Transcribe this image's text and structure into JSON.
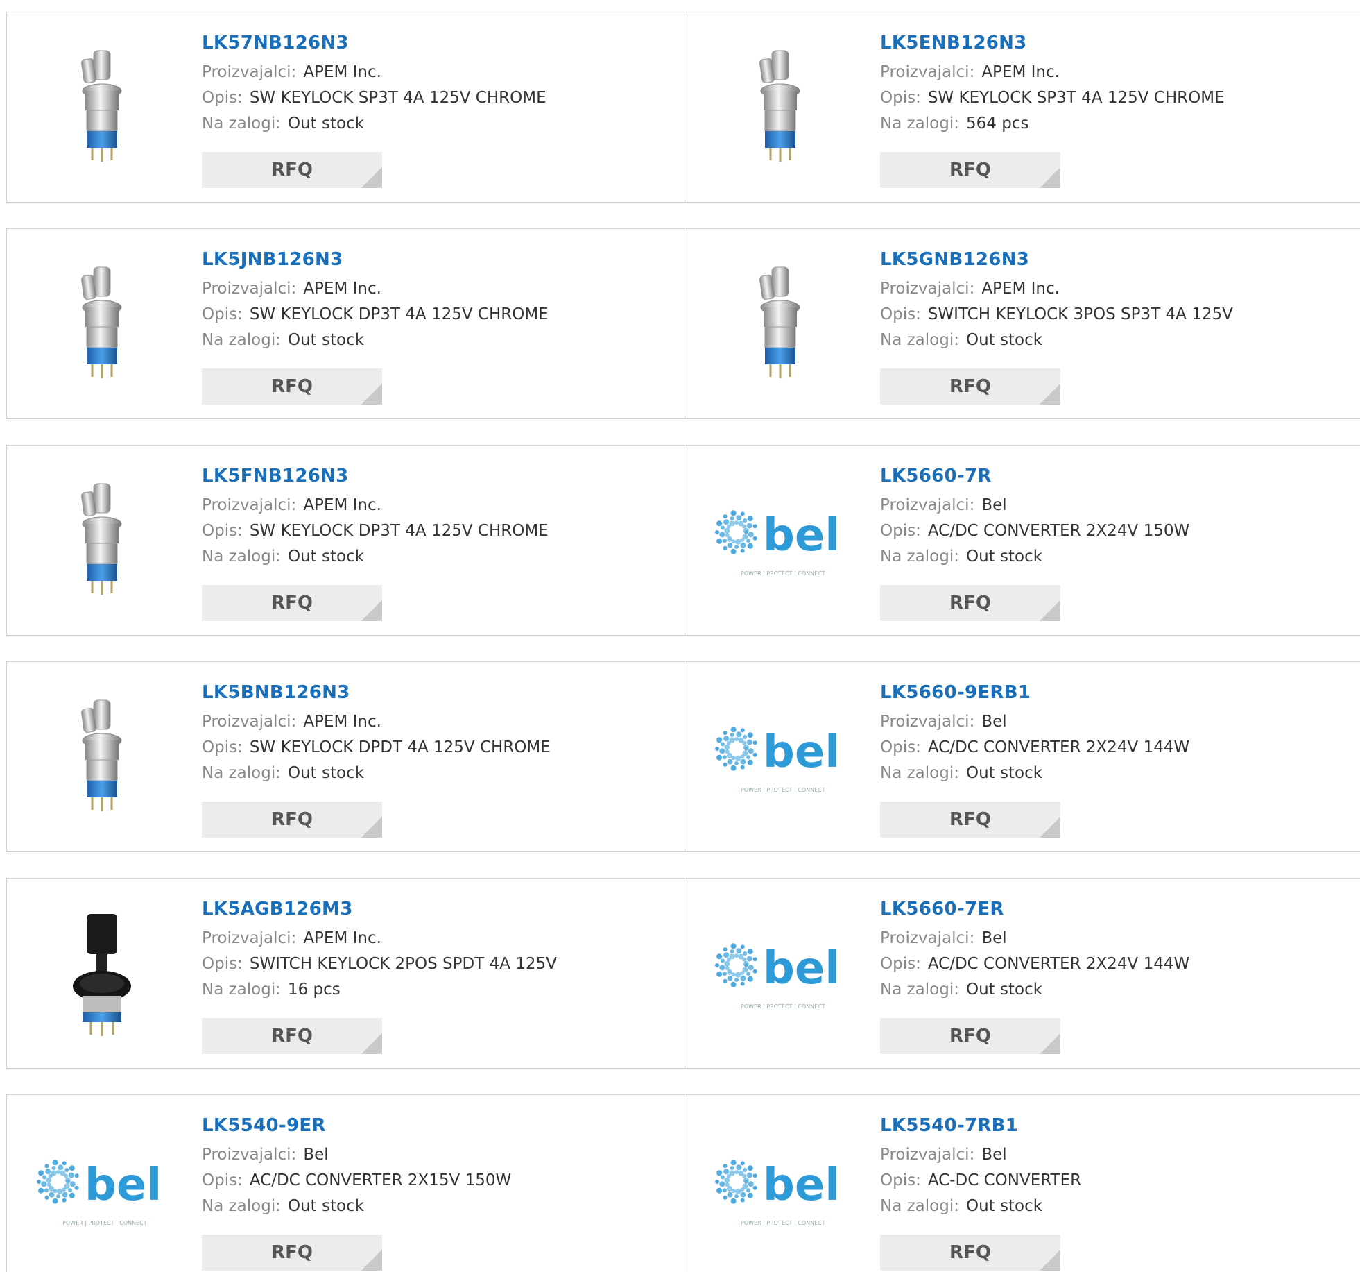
{
  "labels": {
    "manufacturer": "Proizvajalci:",
    "description": "Opis:",
    "stock": "Na zalogi:",
    "rfq": "RFQ"
  },
  "brand_logo": {
    "text": "bel",
    "tagline": "POWER | PROTECT | CONNECT",
    "color": "#2e9ad8"
  },
  "colors": {
    "part_number": "#1a6fba",
    "label": "#888888",
    "button_bg": "#ececec"
  },
  "products": [
    {
      "part": "LK57NB126N3",
      "manufacturer": "APEM Inc.",
      "description": "SW KEYLOCK SP3T 4A 125V CHROME",
      "stock": "Out stock",
      "image": "chrome-keylock-switch"
    },
    {
      "part": "LK5ENB126N3",
      "manufacturer": "APEM Inc.",
      "description": "SW KEYLOCK SP3T 4A 125V CHROME",
      "stock": "564 pcs",
      "image": "chrome-keylock-switch"
    },
    {
      "part": "LK5JNB126N3",
      "manufacturer": "APEM Inc.",
      "description": "SW KEYLOCK DP3T 4A 125V CHROME",
      "stock": "Out stock",
      "image": "chrome-keylock-switch"
    },
    {
      "part": "LK5GNB126N3",
      "manufacturer": "APEM Inc.",
      "description": "SWITCH KEYLOCK 3POS SP3T 4A 125V",
      "stock": "Out stock",
      "image": "chrome-keylock-switch"
    },
    {
      "part": "LK5FNB126N3",
      "manufacturer": "APEM Inc.",
      "description": "SW KEYLOCK DP3T 4A 125V CHROME",
      "stock": "Out stock",
      "image": "chrome-keylock-switch"
    },
    {
      "part": "LK5660-7R",
      "manufacturer": "Bel",
      "description": "AC/DC CONVERTER 2X24V 150W",
      "stock": "Out stock",
      "image": "bel-logo"
    },
    {
      "part": "LK5BNB126N3",
      "manufacturer": "APEM Inc.",
      "description": "SW KEYLOCK DPDT 4A 125V CHROME",
      "stock": "Out stock",
      "image": "chrome-keylock-switch"
    },
    {
      "part": "LK5660-9ERB1",
      "manufacturer": "Bel",
      "description": "AC/DC CONVERTER 2X24V 144W",
      "stock": "Out stock",
      "image": "bel-logo"
    },
    {
      "part": "LK5AGB126M3",
      "manufacturer": "APEM Inc.",
      "description": "SWITCH KEYLOCK 2POS SPDT 4A 125V",
      "stock": "16 pcs",
      "image": "black-keylock-switch"
    },
    {
      "part": "LK5660-7ER",
      "manufacturer": "Bel",
      "description": "AC/DC CONVERTER 2X24V 144W",
      "stock": "Out stock",
      "image": "bel-logo"
    },
    {
      "part": "LK5540-9ER",
      "manufacturer": "Bel",
      "description": "AC/DC CONVERTER 2X15V 150W",
      "stock": "Out stock",
      "image": "bel-logo"
    },
    {
      "part": "LK5540-7RB1",
      "manufacturer": "Bel",
      "description": "AC-DC CONVERTER",
      "stock": "Out stock",
      "image": "bel-logo"
    }
  ]
}
